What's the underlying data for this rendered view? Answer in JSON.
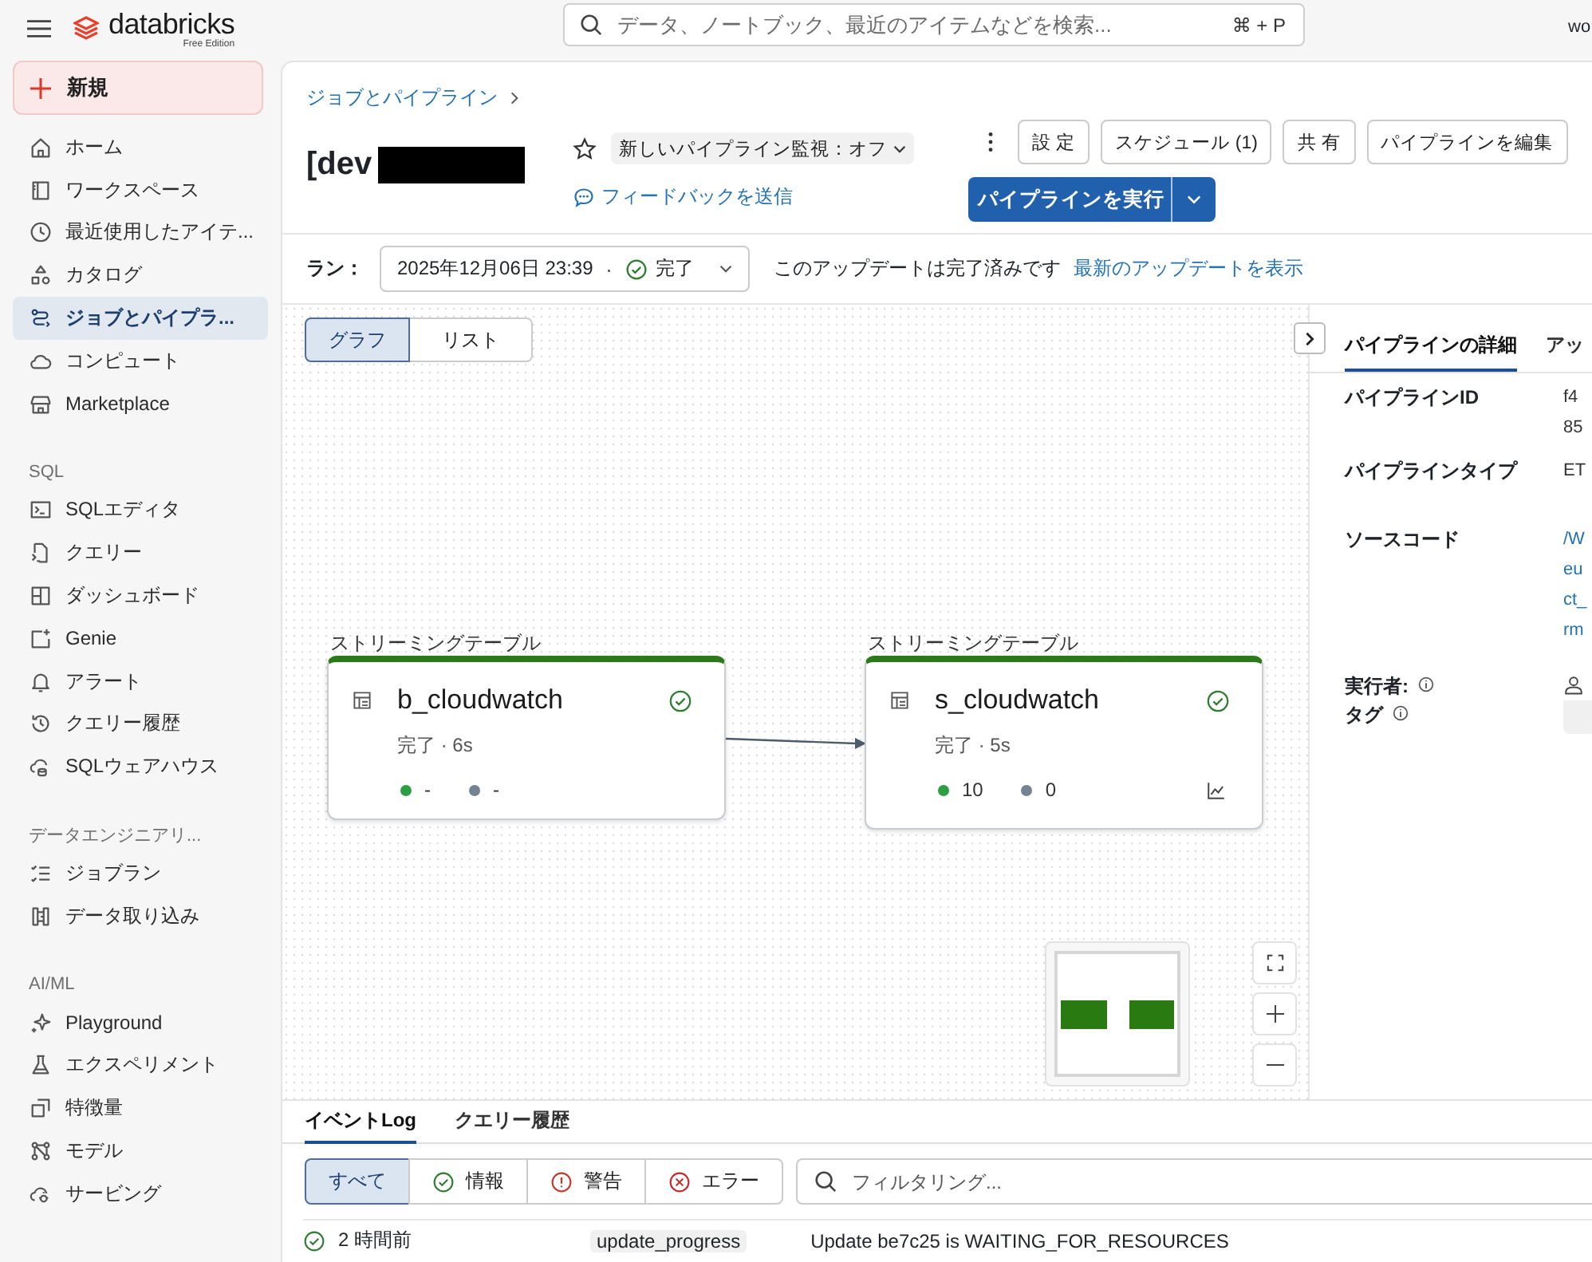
{
  "topbar": {
    "brand": "databricks",
    "edition": "Free Edition",
    "search": {
      "placeholder": "データ、ノートブック、最近のアイテムなどを検索...",
      "shortcut": "⌘ + P"
    },
    "user": "wo"
  },
  "sidebar": {
    "new_button": "新規",
    "sections": [
      {
        "items": [
          {
            "label": "ホーム",
            "selected": false
          },
          {
            "label": "ワークスペース",
            "selected": false
          },
          {
            "label": "最近使用したアイテ...",
            "selected": false
          },
          {
            "label": "カタログ",
            "selected": false
          },
          {
            "label": "ジョブとパイプラ...",
            "selected": true
          },
          {
            "label": "コンピュート",
            "selected": false
          },
          {
            "label": "Marketplace",
            "selected": false
          }
        ]
      },
      {
        "heading": "SQL",
        "items": [
          {
            "label": "SQLエディタ",
            "selected": false
          },
          {
            "label": "クエリー",
            "selected": false
          },
          {
            "label": "ダッシュボード",
            "selected": false
          },
          {
            "label": "Genie",
            "selected": false
          },
          {
            "label": "アラート",
            "selected": false
          },
          {
            "label": "クエリー履歴",
            "selected": false
          },
          {
            "label": "SQLウェアハウス",
            "selected": false
          }
        ]
      },
      {
        "heading": "データエンジニアリ...",
        "items": [
          {
            "label": "ジョブラン",
            "selected": false
          },
          {
            "label": "データ取り込み",
            "selected": false
          }
        ]
      },
      {
        "heading": "AI/ML",
        "items": [
          {
            "label": "Playground",
            "selected": false
          },
          {
            "label": "エクスペリメント",
            "selected": false
          },
          {
            "label": "特徴量",
            "selected": false
          },
          {
            "label": "モデル",
            "selected": false
          },
          {
            "label": "サービング",
            "selected": false
          }
        ]
      }
    ]
  },
  "header": {
    "breadcrumb": "ジョブとパイプライン",
    "title": "[dev",
    "monitor_toggle": "新しいパイプライン監視：オフ",
    "feedback_link": "フィードバックを送信",
    "buttons": [
      "設 定",
      "スケジュール (1)",
      "共 有",
      "パイプラインを編集"
    ],
    "run_button": "パイプラインを実行"
  },
  "run_bar": {
    "label": "ラン：",
    "date": "2025年12月06日 23:39",
    "separator": "·",
    "status": "完了",
    "message": "このアップデートは完了済みです",
    "link": "最新のアップデートを表示"
  },
  "graph": {
    "view_tabs": [
      {
        "label": "グラフ",
        "selected": true
      },
      {
        "label": "リスト",
        "selected": false
      }
    ],
    "nodes": [
      {
        "type_label": "ストリーミングテーブル",
        "name": "b_cloudwatch",
        "status": "完了 · 6s",
        "has_chart": false,
        "metrics": [
          {
            "value": "-",
            "color": "#2e9e44"
          },
          {
            "value": "-",
            "color": "#748394"
          }
        ]
      },
      {
        "type_label": "ストリーミングテーブル",
        "name": "s_cloudwatch",
        "status": "完了 · 5s",
        "has_chart": true,
        "metrics": [
          {
            "value": "10",
            "color": "#2e9e44"
          },
          {
            "value": "0",
            "color": "#748394"
          }
        ]
      }
    ]
  },
  "details": {
    "tabs": [
      {
        "label": "パイプラインの詳細",
        "selected": true
      },
      {
        "label": "アッ",
        "selected": false
      }
    ],
    "rows": [
      {
        "label": "パイプラインID",
        "kind": "text",
        "values": [
          "f4",
          "85"
        ]
      },
      {
        "label": "パイプラインタイプ",
        "kind": "text",
        "values": [
          "ET"
        ]
      },
      {
        "label": "ソースコード",
        "kind": "link",
        "values": [
          "/W",
          "eu",
          "ct_",
          "rm"
        ]
      },
      {
        "label": "実行者:",
        "kind": "user",
        "info": true
      },
      {
        "label": "タグ",
        "kind": "tag",
        "info": true
      }
    ]
  },
  "bottom": {
    "tabs": [
      {
        "label": "イベントLog",
        "selected": true
      },
      {
        "label": "クエリー履歴",
        "selected": false
      }
    ],
    "filters": [
      {
        "label": "すべて",
        "kind": "all",
        "selected": true
      },
      {
        "label": "情報",
        "kind": "info",
        "selected": false
      },
      {
        "label": "警告",
        "kind": "warning",
        "selected": false
      },
      {
        "label": "エラー",
        "kind": "error",
        "selected": false
      }
    ],
    "filter_placeholder": "フィルタリング...",
    "events": [
      {
        "time": "2 時間前",
        "type": "update_progress",
        "message": "Update be7c25 is WAITING_FOR_RESOURCES"
      }
    ]
  }
}
